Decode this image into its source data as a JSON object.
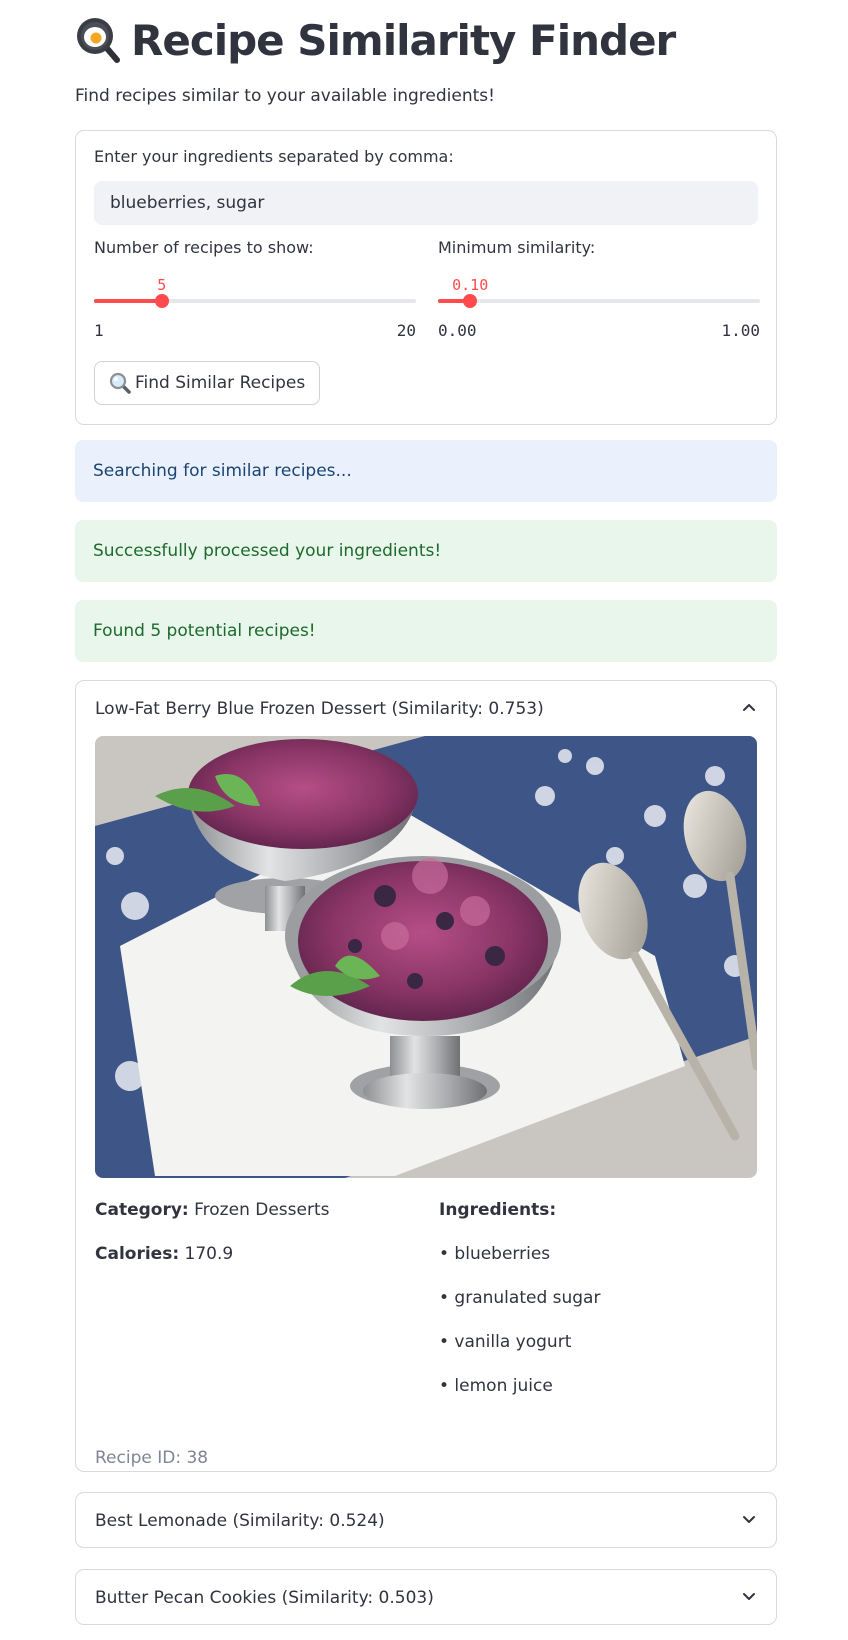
{
  "page": {
    "title": "Recipe Similarity Finder",
    "subtitle": "Find recipes similar to your available ingredients!"
  },
  "form": {
    "ingredients_label": "Enter your ingredients separated by comma:",
    "ingredients_value": "blueberries, sugar",
    "num_recipes": {
      "label": "Number of recipes to show:",
      "value": "5",
      "min": "1",
      "max": "20",
      "level": 0.2105
    },
    "min_similarity": {
      "label": "Minimum similarity:",
      "value": "0.10",
      "min": "0.00",
      "max": "1.00",
      "level": 0.1
    },
    "button_label": "Find Similar Recipes",
    "button_icon": "magnifying-glass-icon"
  },
  "alerts": {
    "searching": "Searching for similar recipes...",
    "processed": "Successfully processed your ingredients!",
    "found": "Found 5 potential recipes!"
  },
  "results": [
    {
      "header": "Low-Fat Berry Blue Frozen Dessert (Similarity: 0.753)",
      "expanded": true,
      "category_label": "Category:",
      "category": "Frozen Desserts",
      "calories_label": "Calories:",
      "calories": "170.9",
      "ingredients_label": "Ingredients:",
      "ingredients": [
        "• blueberries",
        "• granulated sugar",
        "• vanilla yogurt",
        "• lemon juice"
      ],
      "recipe_id": "Recipe ID: 38"
    },
    {
      "header": "Best Lemonade (Similarity: 0.524)",
      "expanded": false
    },
    {
      "header": "Butter Pecan Cookies (Similarity: 0.503)",
      "expanded": false
    }
  ],
  "colors": {
    "accent": "#ff4b4b",
    "info_bg": "#eaf1fc",
    "success_bg": "#e9f6ec",
    "text": "#31333f"
  }
}
